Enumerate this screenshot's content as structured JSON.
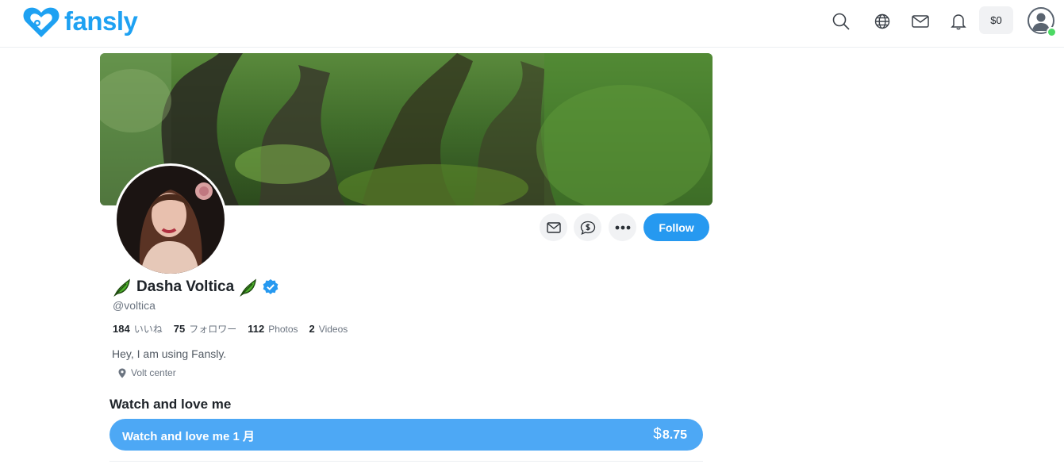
{
  "header": {
    "logo_text": "fansly",
    "icons": [
      "search-icon",
      "globe-icon",
      "mail-icon",
      "bell-icon"
    ],
    "wallet_balance": "$0",
    "accent_color": "#1ea1f2"
  },
  "profile": {
    "display_name": "Dasha Voltica",
    "handle": "@voltica",
    "verified": true,
    "stats": [
      {
        "value": "184",
        "label": "いいね"
      },
      {
        "value": "75",
        "label": "フォロワー"
      },
      {
        "value": "112",
        "label": "Photos"
      },
      {
        "value": "2",
        "label": "Videos"
      }
    ],
    "bio": "Hey, I am using Fansly.",
    "location": "Volt center"
  },
  "actions": {
    "follow_label": "Follow"
  },
  "subscription": {
    "tier_title": "Watch and love me",
    "button_label": "Watch and love me 1 月",
    "price_currency": "$",
    "price_value": "8.75",
    "button_color": "#4da8f5"
  }
}
